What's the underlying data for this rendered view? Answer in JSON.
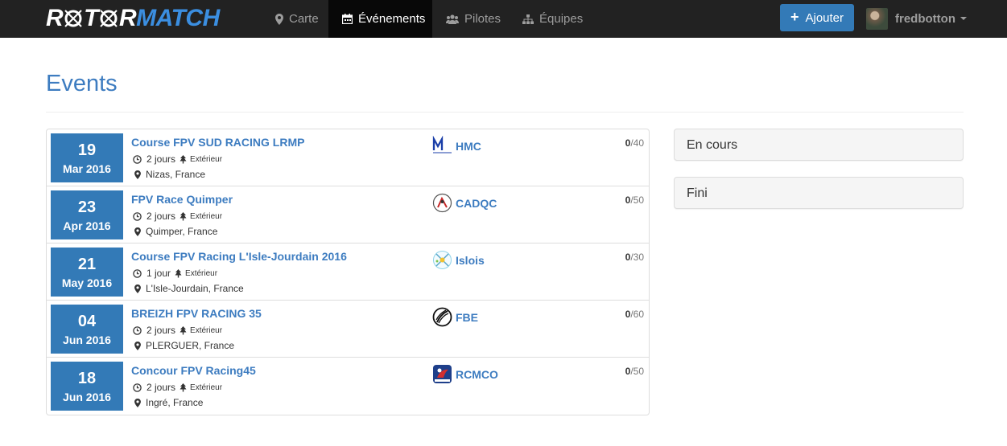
{
  "brand": {
    "part1": "R",
    "part2": "T",
    "part3": "R",
    "part4": "MATCH",
    "accent_color": "#3b8ee0"
  },
  "nav": {
    "items": [
      {
        "label": "Carte",
        "icon": "map-marker-icon"
      },
      {
        "label": "Événements",
        "icon": "calendar-icon",
        "active": true
      },
      {
        "label": "Pilotes",
        "icon": "users-icon"
      },
      {
        "label": "Équipes",
        "icon": "sitemap-icon"
      }
    ],
    "add_label": "Ajouter",
    "username": "fredbotton"
  },
  "page": {
    "title": "Events"
  },
  "events": [
    {
      "day": "19",
      "month": "Mar 2016",
      "title": "Course FPV SUD RACING LRMP",
      "duration": "2 jours",
      "setting": "Extérieur",
      "location": "Nizas, France",
      "team": "HMC",
      "registered": "0",
      "capacity": "/40"
    },
    {
      "day": "23",
      "month": "Apr 2016",
      "title": "FPV Race Quimper",
      "duration": "2 jours",
      "setting": "Extérieur",
      "location": "Quimper, France",
      "team": "CADQC",
      "registered": "0",
      "capacity": "/50"
    },
    {
      "day": "21",
      "month": "May 2016",
      "title": "Course FPV Racing L'Isle-Jourdain 2016",
      "duration": "1 jour",
      "setting": "Extérieur",
      "location": "L'Isle-Jourdain, France",
      "team": "Islois",
      "registered": "0",
      "capacity": "/30"
    },
    {
      "day": "04",
      "month": "Jun 2016",
      "title": "BREIZH FPV RACING 35",
      "duration": "2 jours",
      "setting": "Extérieur",
      "location": "PLERGUER, France",
      "team": "FBE",
      "registered": "0",
      "capacity": "/60"
    },
    {
      "day": "18",
      "month": "Jun 2016",
      "title": "Concour FPV Racing45",
      "duration": "2 jours",
      "setting": "Extérieur",
      "location": "Ingré, France",
      "team": "RCMCO",
      "registered": "0",
      "capacity": "/50"
    }
  ],
  "panels": {
    "current": "En cours",
    "finished": "Fini"
  },
  "colors": {
    "navbar": "#222222",
    "primary": "#337ab7",
    "link": "#3d7cc0"
  }
}
